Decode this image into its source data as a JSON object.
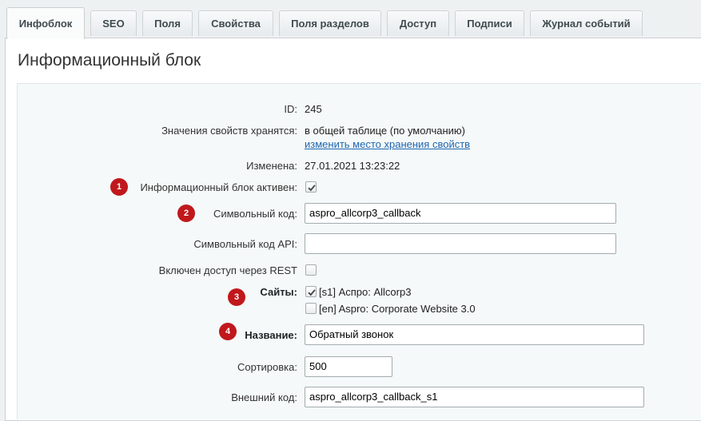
{
  "tabs": [
    {
      "label": "Инфоблок",
      "active": true
    },
    {
      "label": "SEO"
    },
    {
      "label": "Поля"
    },
    {
      "label": "Свойства"
    },
    {
      "label": "Поля разделов"
    },
    {
      "label": "Доступ"
    },
    {
      "label": "Подписи"
    },
    {
      "label": "Журнал событий"
    }
  ],
  "panel_title": "Информационный блок",
  "form": {
    "id": {
      "label": "ID:",
      "value": "245"
    },
    "storage": {
      "label": "Значения свойств хранятся:",
      "value": "в общей таблице (по умолчанию)",
      "link": "изменить место хранения свойств"
    },
    "modified": {
      "label": "Изменена:",
      "value": "27.01.2021 13:23:22"
    },
    "active": {
      "label": "Информационный блок активен:",
      "checked": true,
      "badge": "1"
    },
    "code": {
      "label": "Символьный код:",
      "value": "aspro_allcorp3_callback",
      "badge": "2"
    },
    "api_code": {
      "label": "Символьный код API:",
      "value": ""
    },
    "rest": {
      "label": "Включен доступ через REST",
      "checked": false
    },
    "sites": {
      "label": "Сайты:",
      "badge": "3",
      "options": [
        {
          "label": "[s1] Аспро: Allcorp3",
          "checked": true
        },
        {
          "label": "[en] Aspro: Corporate Website 3.0",
          "checked": false
        }
      ]
    },
    "name": {
      "label": "Название:",
      "value": "Обратный звонок",
      "badge": "4"
    },
    "sort": {
      "label": "Сортировка:",
      "value": "500"
    },
    "xml_id": {
      "label": "Внешний код:",
      "value": "aspro_allcorp3_callback_s1"
    }
  },
  "colors": {
    "badge": "#c0181c",
    "link": "#2067b0",
    "form_bg": "#f5f9f9"
  },
  "icons": {
    "checkbox_checked": "checkmark-icon"
  }
}
